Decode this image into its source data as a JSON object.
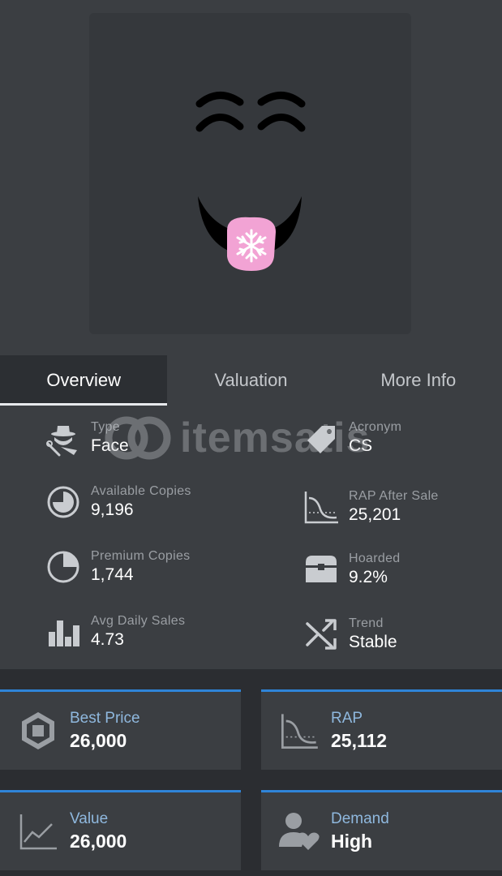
{
  "tabs": [
    {
      "label": "Overview",
      "active": true
    },
    {
      "label": "Valuation",
      "active": false
    },
    {
      "label": "More Info",
      "active": false
    }
  ],
  "watermark": {
    "text": "itemsatis"
  },
  "stats": {
    "type": {
      "label": "Type",
      "value": "Face",
      "icon": "detective-icon"
    },
    "acronym": {
      "label": "Acronym",
      "value": "CS",
      "icon": "tag-icon"
    },
    "available_copies": {
      "label": "Available Copies",
      "value": "9,196",
      "icon": "pie-chart-icon"
    },
    "rap_after_sale": {
      "label": "RAP After Sale",
      "value": "25,201",
      "icon": "rap-curve-icon"
    },
    "premium_copies": {
      "label": "Premium Copies",
      "value": "1,744",
      "icon": "pie-outline-icon"
    },
    "hoarded": {
      "label": "Hoarded",
      "value": "9.2%",
      "icon": "chest-icon"
    },
    "avg_daily_sales": {
      "label": "Avg Daily Sales",
      "value": "4.73",
      "icon": "bar-chart-icon"
    },
    "trend": {
      "label": "Trend",
      "value": "Stable",
      "icon": "shuffle-icon"
    }
  },
  "cards": {
    "best_price": {
      "label": "Best Price",
      "value": "26,000",
      "icon": "robux-icon"
    },
    "rap": {
      "label": "RAP",
      "value": "25,112",
      "icon": "rap-curve-icon"
    },
    "value": {
      "label": "Value",
      "value": "26,000",
      "icon": "line-graph-icon"
    },
    "demand": {
      "label": "Demand",
      "value": "High",
      "icon": "user-heart-icon"
    }
  },
  "colors": {
    "accent": "#2f84d8",
    "card_label": "#8fb8de",
    "background": "#3b3e42",
    "tongue": "#f2a3d4"
  }
}
